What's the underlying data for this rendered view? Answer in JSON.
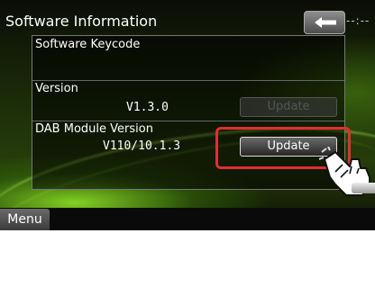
{
  "header": {
    "title": "Software Information",
    "back_icon": "back-arrow-icon",
    "clock": "--:--"
  },
  "rows": [
    {
      "label": "Software Keycode",
      "value": ""
    },
    {
      "label": "Version",
      "value": "V1.3.0",
      "button": "Update",
      "button_enabled": false
    },
    {
      "label": "DAB Module Version",
      "value": "V110/10.1.3",
      "button": "Update",
      "button_enabled": true
    }
  ],
  "footer": {
    "menu_label": "Menu"
  },
  "colors": {
    "highlight": "#e0302e",
    "accent_green": "#8ee033"
  },
  "annotation_icon": "pointing-hand-icon"
}
